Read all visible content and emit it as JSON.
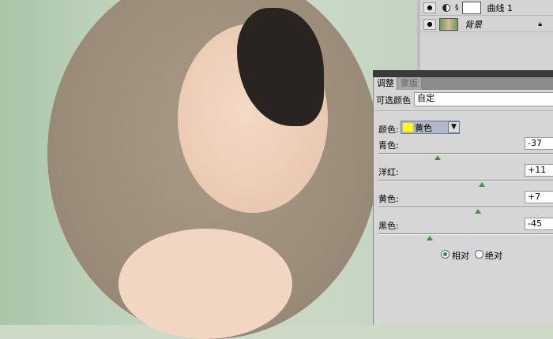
{
  "layers": [
    {
      "name": "曲线 1",
      "icons": [
        "eye-icon",
        "adjustment-icon",
        "link-icon",
        "mask-thumbnail"
      ]
    },
    {
      "name": "背景",
      "icons": [
        "eye-icon",
        "image-thumbnail",
        "lock-icon"
      ]
    }
  ],
  "adjustments": {
    "tabs": [
      "调整",
      "蒙版"
    ],
    "preset_label": "可选颜色",
    "preset_value": "自定",
    "color_label": "颜色:",
    "color_value": "黄色",
    "swatch": "#ffff00",
    "sliders": [
      {
        "label": "青色:",
        "value": "-37",
        "num": -37
      },
      {
        "label": "洋红:",
        "value": "+11",
        "num": 11
      },
      {
        "label": "黄色:",
        "value": "+7",
        "num": 7
      },
      {
        "label": "黑色:",
        "value": "-45",
        "num": -45
      }
    ],
    "method": [
      {
        "label": "相对",
        "checked": true
      },
      {
        "label": "绝对",
        "checked": false
      }
    ]
  }
}
